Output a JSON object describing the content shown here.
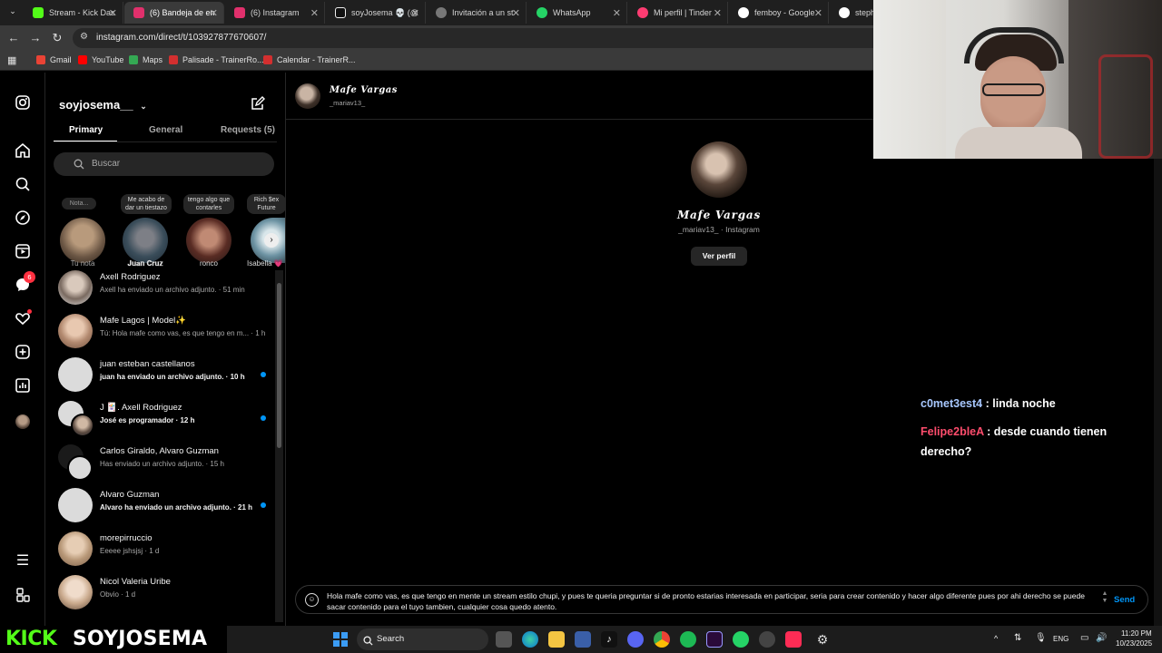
{
  "browser": {
    "tabs": [
      {
        "label": "Stream - Kick Das",
        "color": "#53fc18"
      },
      {
        "label": "(6) Bandeja de en",
        "color": "#e1306c"
      },
      {
        "label": "(6) Instagram",
        "color": "#e1306c"
      },
      {
        "label": "soyJosema 💀 (@",
        "color": "#ffffff"
      },
      {
        "label": "Invitación a un st",
        "color": "#cccccc"
      },
      {
        "label": "WhatsApp",
        "color": "#25d366"
      },
      {
        "label": "Mi perfil | Tinder",
        "color": "#fe3c72"
      },
      {
        "label": "femboy - Google",
        "color": "#ffffff"
      },
      {
        "label": "stephen",
        "color": "#ffffff"
      }
    ],
    "url": "instagram.com/direct/t/103927877670607/",
    "bookmarks": [
      {
        "label": "Gmail",
        "color": "#ea4335"
      },
      {
        "label": "YouTube",
        "color": "#ff0000"
      },
      {
        "label": "Maps",
        "color": "#34a853"
      },
      {
        "label": "Palisade - TrainerRo...",
        "color": "#d32f2f"
      },
      {
        "label": "Calendar - TrainerR...",
        "color": "#d32f2f"
      }
    ]
  },
  "inbox": {
    "username": "soyjosema__",
    "tabs": {
      "primary": "Primary",
      "general": "General",
      "requests": "Requests (5)"
    },
    "search_placeholder": "Buscar",
    "notes": [
      {
        "bubble": "Nota...",
        "name": "Tu nota"
      },
      {
        "bubble": "Me acabo de dar un tiestazo",
        "name": "𝐉𝐮𝐚𝐧 𝐂𝐫𝐮𝐳"
      },
      {
        "bubble": "tengo algo que contarles",
        "name": "ronco"
      },
      {
        "bubble": "Rich $ex Future",
        "name": "Isabella 💗"
      }
    ],
    "threads": [
      {
        "name": "Axell Rodriguez",
        "preview": "Axell ha enviado un archivo adjunto. · 51 min",
        "bold": false,
        "unread": false
      },
      {
        "name": "Mafe Lagos | Model✨",
        "preview": "Tú: Hola mafe como vas, es que tengo en m... · 1 h",
        "bold": false,
        "unread": false
      },
      {
        "name": "juan esteban castellanos",
        "preview": "juan ha enviado un archivo adjunto. · 10 h",
        "bold": true,
        "unread": true
      },
      {
        "name": "J 🃏. Axell Rodriguez",
        "preview": "José es programador · 12 h",
        "bold": true,
        "unread": true
      },
      {
        "name": "Carlos Giraldo, Alvaro Guzman",
        "preview": "Has enviado un archivo adjunto. · 15 h",
        "bold": false,
        "unread": false
      },
      {
        "name": "Alvaro Guzman",
        "preview": "Alvaro ha enviado un archivo adjunto. · 21 h",
        "bold": true,
        "unread": true
      },
      {
        "name": "morepirruccio",
        "preview": "Eeeee jshsjsj · 1 d",
        "bold": false,
        "unread": false
      },
      {
        "name": "Nicol Valeria Uribe",
        "preview": "Obvio · 1 d",
        "bold": false,
        "unread": false
      }
    ],
    "rail_badge": "6"
  },
  "chat": {
    "name": "Mafe Vargas",
    "handle": "_mariav13_",
    "profile_sub": "_mariav13_ · Instagram",
    "view_profile": "Ver perfil",
    "composer_text": "Hola mafe como vas, es que tengo en mente un stream estilo chupi, y pues te queria preguntar si de pronto estarias interesada en participar, seria para crear contenido y hacer algo diferente pues por ahi derecho se puede sacar contenido para el tuyo tambien, cualquier cosa quedo atento.",
    "send": "Send"
  },
  "overlay": {
    "chat": [
      {
        "user": "c0met3est4",
        "user_color": "#a8c8ff",
        "message": " : linda noche"
      },
      {
        "user": "Felipe2bleA",
        "user_color": "#ff4d6d",
        "message": " : desde cuando tienen derecho?"
      }
    ],
    "kick_logo": "KICK",
    "channel": "SOYJOSEMA"
  },
  "taskbar": {
    "search": "Search",
    "lang": "ENG",
    "time": "11:20 PM",
    "date": "10/23/2025"
  }
}
